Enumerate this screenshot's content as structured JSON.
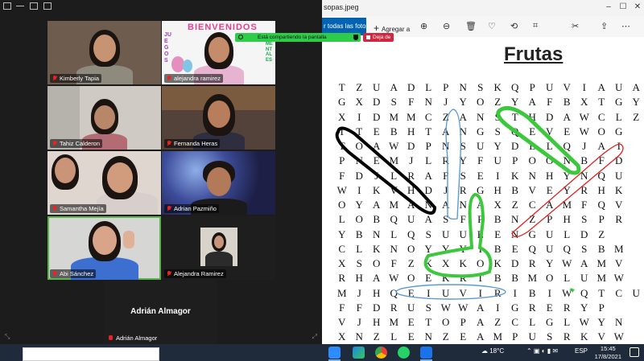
{
  "zoom": {
    "participants": [
      {
        "name": "Kimberly Tapia"
      },
      {
        "name": "alejandra ramirez"
      },
      {
        "name": "Tahiz Calderon"
      },
      {
        "name": "Fernanda Heras"
      },
      {
        "name": "Samantha Mejía"
      },
      {
        "name": "Adrian Pazmiño"
      },
      {
        "name": "Abi Sánchez"
      },
      {
        "name": "Alejandra Ramirez"
      },
      {
        "name": "Adrián Almagor"
      }
    ],
    "name_only_tile": "Adrián Almagor",
    "share_banner": "Está compartiendo la pantalla",
    "stop_share": "Deja de",
    "banner_text": {
      "top": "BIENVENIDOS",
      "left": "JUEGOS",
      "right": "MENTALES"
    }
  },
  "photos": {
    "filename": "sopas.jpeg",
    "see_all": "r todas las fotos",
    "add_label": "Agregar a",
    "puzzle_title": "Frutas",
    "grid": [
      "TZUADLPNSKQPUVIAUA",
      "GXDSFNJYOZYAFBXTGY",
      "XIDMMCZANSTHDAWCLZO",
      "TTEBHTANGSQEVEWOG",
      "TOAWDPNSUYDLLQJAI",
      "PNEMJLRYFUPOONBFD",
      "FDJLRAFSEIKNHYNQU",
      "WIKVHDJRGHBVEYRHK",
      "OYAMANANAXZCAMFQV",
      "LOBQUASFPBNZPHSPR",
      "YBNLQSUUEENGULDZ",
      "CLKNOYYYIBEQUQSBM",
      "XSOFZKXKOKDRYWAMV",
      "RHAWOEKRTBBMOLUMW",
      "MJHQEIUVIRIBIWQTCU",
      "FFDRUSWWAIGRERYP",
      "VJHMETOPAZCLGLWYN",
      "XNZLENZEAMPUSRKVW"
    ]
  },
  "taskbar": {
    "weather": "18°C",
    "lang": "ESP",
    "time": "15:45",
    "date": "17/8/2021"
  },
  "colors": {
    "zoom_bg": "#1c1c1c",
    "share_green": "#2dcc49",
    "stop_red": "#d0273e",
    "photos_accent": "#0063b1",
    "taskbar": "#1f2a3a",
    "mark_blue": "#5b9bd5",
    "mark_green": "#3cc83c",
    "mark_red": "#e02020",
    "mark_black": "#000000"
  }
}
